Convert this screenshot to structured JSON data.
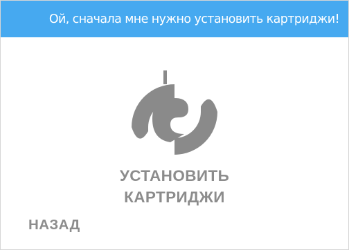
{
  "header": {
    "message": "Ой, сначала мне нужно установить картриджи!"
  },
  "install": {
    "label_line1": "УСТАНОВИТЬ",
    "label_line2": "КАРТРИДЖИ",
    "icon": "cartridge-icon"
  },
  "back": {
    "label": "НАЗАД"
  },
  "colors": {
    "header_bg": "#46a9f0",
    "header_text": "#ffffff",
    "icon": "#8a8a8a",
    "label": "#8c8c8c",
    "background": "#ffffff"
  }
}
